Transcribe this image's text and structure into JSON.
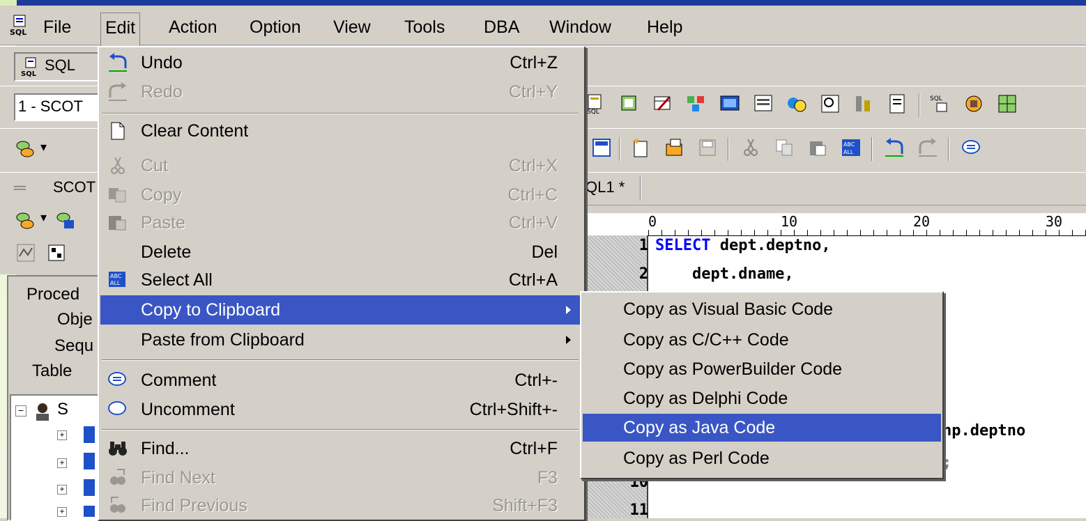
{
  "menubar": {
    "items": [
      {
        "label": "File",
        "mnemonic": "F"
      },
      {
        "label": "Edit",
        "mnemonic": "E"
      },
      {
        "label": "Action",
        "mnemonic": "A"
      },
      {
        "label": "Option",
        "mnemonic": "O"
      },
      {
        "label": "View",
        "mnemonic": "V"
      },
      {
        "label": "Tools",
        "mnemonic": "T"
      },
      {
        "label": "DBA",
        "mnemonic": "D"
      },
      {
        "label": "Window",
        "mnemonic": "W"
      },
      {
        "label": "Help",
        "mnemonic": "H"
      }
    ]
  },
  "toolbar": {
    "sql_tab_label": "SQL",
    "connection_value": "1 - SCOT",
    "schema_label": "SCOT",
    "editor_tab_label": "QL1 *"
  },
  "left_panel": {
    "labels": [
      "Proced",
      "Obje",
      "Sequ",
      "Table"
    ],
    "tree_root_label": "S"
  },
  "edit_menu": {
    "items": [
      {
        "label": "Undo",
        "shortcut": "Ctrl+Z",
        "enabled": true,
        "icon": "undo-icon"
      },
      {
        "label": "Redo",
        "shortcut": "Ctrl+Y",
        "enabled": false,
        "icon": "redo-icon"
      },
      {
        "label": "Clear Content",
        "shortcut": "",
        "enabled": true,
        "icon": "clear-content-icon"
      },
      {
        "label": "Cut",
        "shortcut": "Ctrl+X",
        "enabled": false,
        "icon": "scissors-icon"
      },
      {
        "label": "Copy",
        "shortcut": "Ctrl+C",
        "enabled": false,
        "icon": "copy-icon"
      },
      {
        "label": "Paste",
        "shortcut": "Ctrl+V",
        "enabled": false,
        "icon": "paste-icon"
      },
      {
        "label": "Delete",
        "shortcut": "Del",
        "enabled": true,
        "icon": ""
      },
      {
        "label": "Select All",
        "shortcut": "Ctrl+A",
        "enabled": true,
        "icon": "select-all-icon"
      },
      {
        "label": "Copy to Clipboard",
        "shortcut": "",
        "enabled": true,
        "submenu": true,
        "selected": true
      },
      {
        "label": "Paste from Clipboard",
        "shortcut": "",
        "enabled": true,
        "submenu": true
      },
      {
        "label": "Comment",
        "shortcut": "Ctrl+-",
        "enabled": true,
        "icon": "comment-icon"
      },
      {
        "label": "Uncomment",
        "shortcut": "Ctrl+Shift+-",
        "enabled": true,
        "icon": "uncomment-icon"
      },
      {
        "label": "Find...",
        "shortcut": "Ctrl+F",
        "enabled": true,
        "icon": "binoculars-icon"
      },
      {
        "label": "Find Next",
        "shortcut": "F3",
        "enabled": false,
        "icon": "find-next-icon"
      },
      {
        "label": "Find Previous",
        "shortcut": "Shift+F3",
        "enabled": false,
        "icon": "find-previous-icon"
      }
    ]
  },
  "clipboard_submenu": {
    "items": [
      {
        "label": "Copy as Visual Basic Code"
      },
      {
        "label": "Copy as C/C++ Code"
      },
      {
        "label": "Copy as PowerBuilder Code"
      },
      {
        "label": "Copy as Delphi Code"
      },
      {
        "label": "Copy as Java Code",
        "selected": true
      },
      {
        "label": "Copy as Perl Code"
      }
    ]
  },
  "editor": {
    "ruler_marks": [
      "0",
      "10",
      "20",
      "30"
    ],
    "lines": [
      {
        "num": "1",
        "text_kw": "SELECT",
        "text": " dept.deptno,"
      },
      {
        "num": "2",
        "text_kw": "",
        "text": "    dept.dname,"
      },
      {
        "num": "10",
        "text_kw": "",
        "text": ""
      },
      {
        "num": "11",
        "text_kw": "",
        "text": ""
      }
    ],
    "visible_fragments": [
      "np.deptno",
      ";"
    ]
  },
  "colors": {
    "highlight": "#3a56c4",
    "keyword": "#0000ff",
    "title_blue": "#1c3c9c"
  }
}
